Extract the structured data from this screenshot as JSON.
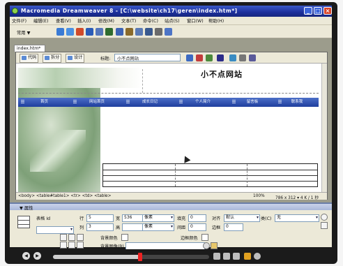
{
  "window": {
    "title": "Macromedia Dreamweaver 8 - [C:\\website\\ch17\\geren\\index.htm*]",
    "min": "_",
    "max": "□",
    "close": "×"
  },
  "menubar": [
    "文件(F)",
    "编辑(E)",
    "查看(V)",
    "插入(I)",
    "修改(M)",
    "文本(T)",
    "命令(C)",
    "站点(S)",
    "窗口(W)",
    "帮助(H)"
  ],
  "insertbar": {
    "category": "常用 ▼"
  },
  "document": {
    "tab": "index.htm*",
    "views": [
      "代码",
      "拆分",
      "设计"
    ],
    "title_label": "标题:",
    "title_value": "小不点网站"
  },
  "canvas": {
    "site_title": "小不点网站",
    "nav": [
      "首页",
      "网站首页",
      "成长日记",
      "个人简介",
      "留言板",
      "联系我"
    ]
  },
  "statusbar": {
    "tagpath": "<body> <table#table1> <tr> <td> <table>",
    "zoom": "100%",
    "dims": "786 x 312 ▾ 4 K / 1 秒"
  },
  "properties": {
    "header": "▼ 属性",
    "table_label": "表格 Id",
    "rows_label": "行",
    "rows_value": "5",
    "cols_label": "列",
    "cols_value": "3",
    "width_label": "宽",
    "width_value": "536",
    "width_unit": "像素",
    "height_label": "高",
    "height_unit": "像素",
    "padding_label": "填充",
    "padding_value": "0",
    "spacing_label": "间距",
    "spacing_value": "0",
    "align_label": "对齐",
    "align_value": "默认",
    "border_label": "边框",
    "border_value": "0",
    "class_label": "类(C)",
    "class_value": "无",
    "bgcolor_label": "背景颜色",
    "bordercolor_label": "边框颜色",
    "bgimage_label": "背景图像(B)"
  },
  "colors": {
    "titlebar": "#1c2f9c",
    "nav_bar": "#2f4fae",
    "panel": "#ece9d8",
    "seek_handle": "#e22222"
  },
  "player": {
    "seek_fraction": 0.56
  }
}
